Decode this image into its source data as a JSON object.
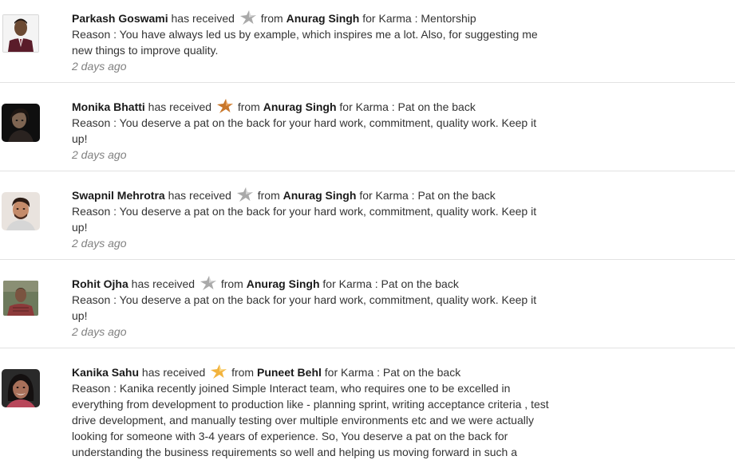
{
  "entries": [
    {
      "recipient": "Parkash Goswami",
      "received_text": "has received",
      "star": "silver-star-icon",
      "from_text": "from",
      "giver": "Anurag Singh",
      "karma_text": "for Karma : Mentorship",
      "reason": "Reason : You have always led us by example, which inspires me a lot. Also, for suggesting me new things to improve quality.",
      "time": "2 days ago"
    },
    {
      "recipient": "Monika Bhatti",
      "received_text": "has received",
      "star": "bronze-star-icon",
      "from_text": "from",
      "giver": "Anurag Singh",
      "karma_text": "for Karma : Pat on the back",
      "reason": "Reason : You deserve a pat on the back for your hard work, commitment, quality work. Keep it up!",
      "time": "2 days ago"
    },
    {
      "recipient": "Swapnil Mehrotra",
      "received_text": "has received",
      "star": "silver-star-icon",
      "from_text": "from",
      "giver": "Anurag Singh",
      "karma_text": "for Karma : Pat on the back",
      "reason": "Reason : You deserve a pat on the back for your hard work, commitment, quality work. Keep it up!",
      "time": "2 days ago"
    },
    {
      "recipient": "Rohit Ojha",
      "received_text": "has received",
      "star": "silver-star-icon",
      "from_text": "from",
      "giver": "Anurag Singh",
      "karma_text": "for Karma : Pat on the back",
      "reason": "Reason : You deserve a pat on the back for your hard work, commitment, quality work. Keep it up!",
      "time": "2 days ago"
    },
    {
      "recipient": "Kanika Sahu",
      "received_text": "has received",
      "star": "gold-star-icon",
      "from_text": "from",
      "giver": "Puneet Behl",
      "karma_text": "for Karma : Pat on the back",
      "reason": "Reason : Kanika recently joined Simple Interact team, who requires one to be excelled in everything from development to production like - planning sprint, writing acceptance criteria , test drive development, and manually testing over multiple environments etc and we were actually looking for someone with 3-4 years of experience. So, You deserve a pat on the back for understanding the business requirements so well and helping us moving forward in such a",
      "time": ""
    }
  ],
  "colors": {
    "silver_star": "#a9a9a9",
    "bronze_star": "#c8762a",
    "gold_star": "#f2b33d",
    "divider": "#e2e2e2",
    "time_text": "#808080"
  }
}
